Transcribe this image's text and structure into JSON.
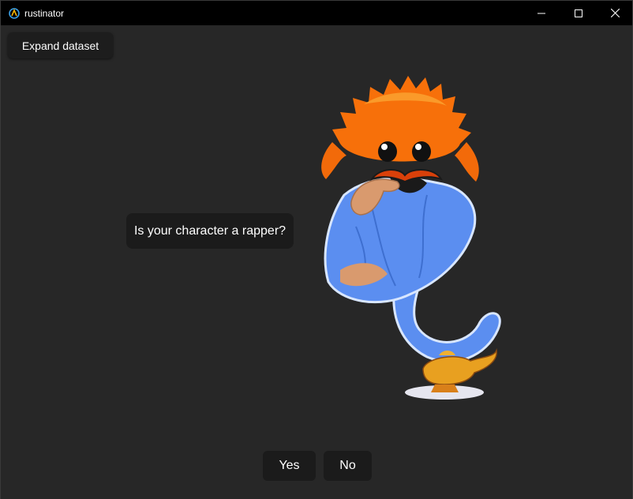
{
  "window": {
    "title": "rustinator",
    "icon": "rustinator-app-icon",
    "controls": [
      "minimize-icon",
      "maximize-icon",
      "close-icon"
    ]
  },
  "toolbar": {
    "expand_label": "Expand dataset"
  },
  "question": {
    "text": "Is your character a rapper?"
  },
  "answers": {
    "yes_label": "Yes",
    "no_label": "No"
  },
  "illustration": {
    "name": "ferris-crab-genie",
    "colors": {
      "crab": "#f76b0a",
      "robe": "#5b8ef0",
      "lamp": "#e8a020",
      "background": "#272727"
    }
  }
}
